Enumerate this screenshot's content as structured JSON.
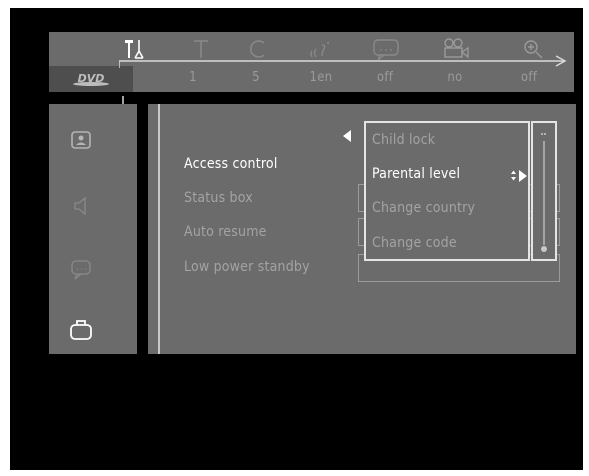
{
  "topbar": {
    "icons": [
      {
        "name": "setup-tools-icon",
        "active": true
      },
      {
        "name": "title-icon",
        "active": false
      },
      {
        "name": "chapter-icon",
        "active": false
      },
      {
        "name": "audio-icon",
        "active": false
      },
      {
        "name": "subtitle-icon",
        "active": false
      },
      {
        "name": "camera-angle-icon",
        "active": false
      },
      {
        "name": "zoom-icon",
        "active": false
      }
    ],
    "disc_logo": "DVD",
    "values": [
      "1",
      "5",
      "1en",
      "off",
      "no",
      "off"
    ]
  },
  "left_menu": {
    "categories": [
      "picture-icon",
      "sound-icon",
      "language-icon",
      "features-icon"
    ],
    "selected": "features-icon"
  },
  "settings": {
    "items": [
      {
        "label": "Access control",
        "selected": true
      },
      {
        "label": "Status box",
        "selected": false
      },
      {
        "label": "Auto resume",
        "selected": false
      },
      {
        "label": "Low power standby",
        "selected": false
      }
    ]
  },
  "submenu": {
    "options": [
      {
        "label": "Child lock",
        "selected": false
      },
      {
        "label": "Parental level",
        "selected": true
      },
      {
        "label": "Change country",
        "selected": false
      },
      {
        "label": "Change code",
        "selected": false
      }
    ]
  },
  "colors": {
    "panel": "#6b6b6b",
    "background": "#000000",
    "highlight": "#ffffff",
    "dim_text": "#a3a3a3"
  }
}
